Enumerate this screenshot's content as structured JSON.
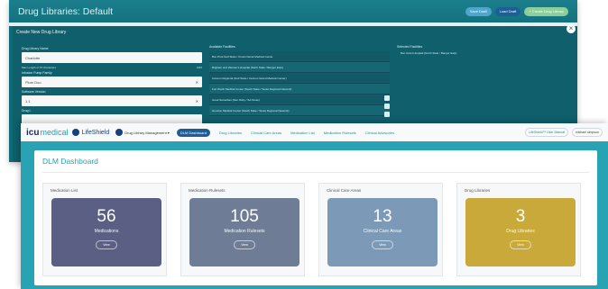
{
  "colors": {
    "teal": "#0b6a78",
    "navy_tab": "#1f5e93",
    "tile1": "#5c5f84",
    "tile2": "#6e7d95",
    "tile3": "#7d99b8",
    "tile4": "#c9a93a"
  },
  "back_window": {
    "title": "Drug Libraries: Default",
    "buttons": [
      "Save Draft",
      "Load Draft",
      "+ Create Drug Library"
    ],
    "modal": {
      "title": "Create New Drug Library",
      "name_label": "Drug Library Name",
      "name_value": "Charlotte",
      "max_note": "Max Length of 15 characters",
      "count": "9/15",
      "pump_label": "Infusion Pump Family",
      "pump_value": "Plum Duo",
      "sw_label": "Software Version",
      "sw_value": "1.1",
      "drug_label": "Drug L",
      "available_label": "Available Facilities",
      "selected_label": "Selected Facilities",
      "available": [
        "Bon Print Gulf State / Crown Derek Medical Center",
        "Brigham and Women's Hospital (North State / Bangor East)",
        "Cannon Regional (Gulf State / Cannon Grand Medical Center)",
        "Fort Worth Medical Center (South State / Texas Regional Network)",
        "Good Samaritan (San Ruby / SA Texas)",
        "Houston Medical Center (South State / Texas Regional Network)"
      ],
      "selected": [
        "Bon Grant Hospital (North State / Bangor East)"
      ]
    }
  },
  "front_window": {
    "nav": {
      "logo": "icu",
      "logo2": "medical",
      "lifeshield": "LifeShield",
      "dropdown": "Drug Library Management",
      "tabs": [
        "DLM Dashboard",
        "Drug Libraries",
        "Clinical Care Areas",
        "Medication List",
        "Medication Rulesets",
        "Clinical Advisories"
      ],
      "user_manual": "LifeShield™ User Manual",
      "user": "michael simpson"
    },
    "panel_title": "DLM Dashboard",
    "cards": [
      {
        "title": "Medication List",
        "value": "56",
        "label": "Medications",
        "button": "View"
      },
      {
        "title": "Medication Rulesets",
        "value": "105",
        "label": "Medication Rulesets",
        "button": "View"
      },
      {
        "title": "Clinical Care Areas",
        "value": "13",
        "label": "Clinical Care Areas",
        "button": "View"
      },
      {
        "title": "Drug Libraries",
        "value": "3",
        "label": "Drug Libraries",
        "button": "View"
      }
    ]
  }
}
